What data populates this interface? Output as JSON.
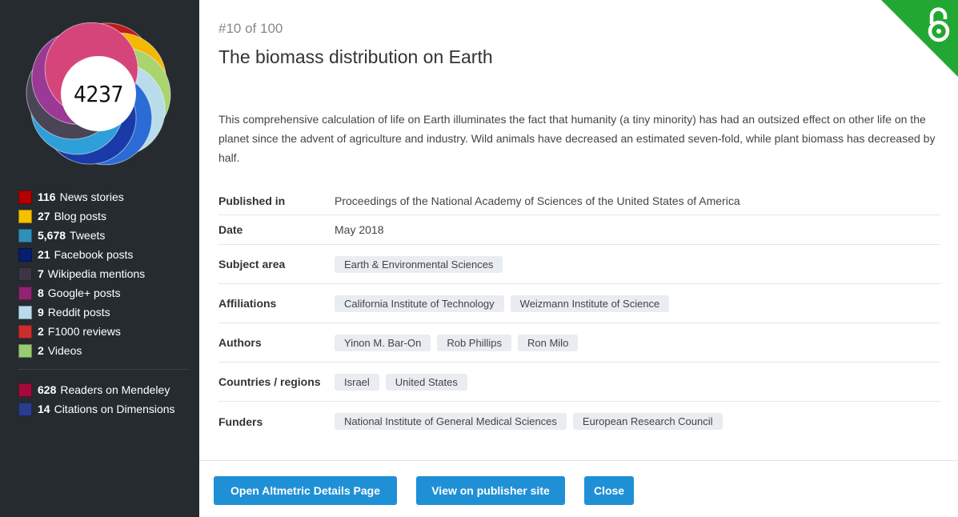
{
  "score": "4237",
  "stats": [
    {
      "count": "116",
      "label": "News stories",
      "color": "#b30000"
    },
    {
      "count": "27",
      "label": "Blog posts",
      "color": "#f5c000"
    },
    {
      "count": "5,678",
      "label": "Tweets",
      "color": "#2f90b9"
    },
    {
      "count": "21",
      "label": "Facebook posts",
      "color": "#071d70"
    },
    {
      "count": "7",
      "label": "Wikipedia mentions",
      "color": "#3c3546"
    },
    {
      "count": "8",
      "label": "Google+ posts",
      "color": "#912470"
    },
    {
      "count": "9",
      "label": "Reddit posts",
      "color": "#b9dbeb"
    },
    {
      "count": "2",
      "label": "F1000 reviews",
      "color": "#cb2d2d"
    },
    {
      "count": "2",
      "label": "Videos",
      "color": "#98c973"
    }
  ],
  "readers": [
    {
      "count": "628",
      "label": "Readers on Mendeley",
      "color": "#a60a3c"
    },
    {
      "count": "14",
      "label": "Citations on Dimensions",
      "color": "#2a3c8f"
    }
  ],
  "donut_colors": [
    "#c01a1a",
    "#f5b800",
    "#a9d46f",
    "#b9dceb",
    "#2b6bd6",
    "#1a3aa8",
    "#2e9fd8",
    "#4a4456",
    "#9a3a95",
    "#d6457a"
  ],
  "rank": "#10 of 100",
  "title": "The biomass distribution on Earth",
  "summary": "This comprehensive calculation of life on Earth illuminates the fact that humanity (a tiny minority) has had an outsized effect on other life on the planet since the advent of agriculture and industry. Wild animals have decreased an estimated seven-fold, while plant biomass has decreased by half.",
  "meta": {
    "published_label": "Published in",
    "published_value": "Proceedings of the National Academy of Sciences of the United States of America",
    "date_label": "Date",
    "date_value": "May 2018",
    "subject_label": "Subject area",
    "subjects": [
      "Earth & Environmental Sciences"
    ],
    "affiliations_label": "Affiliations",
    "affiliations": [
      "California Institute of Technology",
      "Weizmann Institute of Science"
    ],
    "authors_label": "Authors",
    "authors": [
      "Yinon M. Bar-On",
      "Rob Phillips",
      "Ron Milo"
    ],
    "countries_label": "Countries / regions",
    "countries": [
      "Israel",
      "United States"
    ],
    "funders_label": "Funders",
    "funders": [
      "National Institute of General Medical Sciences",
      "European Research Council"
    ]
  },
  "buttons": {
    "details": "Open Altmetric Details Page",
    "publisher": "View on publisher site",
    "close": "Close"
  },
  "open_access_icon": "open-access-lock-icon",
  "ribbon_color": "#22a832"
}
